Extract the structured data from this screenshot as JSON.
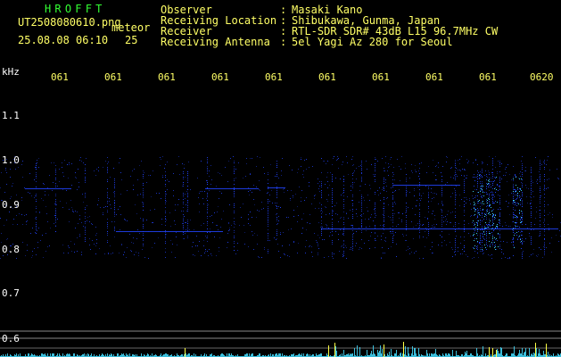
{
  "header": {
    "brand": "HROFFT",
    "filename": "UT2508080610.png",
    "tag": "meteor",
    "timestamp": "25.08.08 06:10",
    "count": "25",
    "fields": [
      {
        "label": "Observer",
        "value": "Masaki Kano"
      },
      {
        "label": "Receiving Location",
        "value": "Shibukawa, Gunma, Japan"
      },
      {
        "label": "Receiver",
        "value": "RTL-SDR SDR# 43dB L15 96.7MHz CW"
      },
      {
        "label": "Receiving Antenna",
        "value": "5el Yagi Az 280 for Seoul"
      }
    ],
    "separator": ":"
  },
  "axes": {
    "y_unit": "kHz",
    "y_ticks": [
      "1.1",
      "1.0",
      "0.9",
      "0.8",
      "0.7",
      "0.6"
    ],
    "x_ticks": [
      "0610",
      "0611",
      "0612",
      "0613",
      "0614",
      "0615",
      "0616",
      "0617",
      "0618",
      "0619",
      "0620"
    ]
  },
  "colors": {
    "background": "#000000",
    "label_yellow": "#ffff66",
    "label_white": "#ffffff",
    "brand_green": "#33ff33",
    "signal_blue": "#2244ff",
    "signal_cyan": "#44ddff",
    "peak_yellow": "#ffff44",
    "guide_gray": "#888888"
  }
}
